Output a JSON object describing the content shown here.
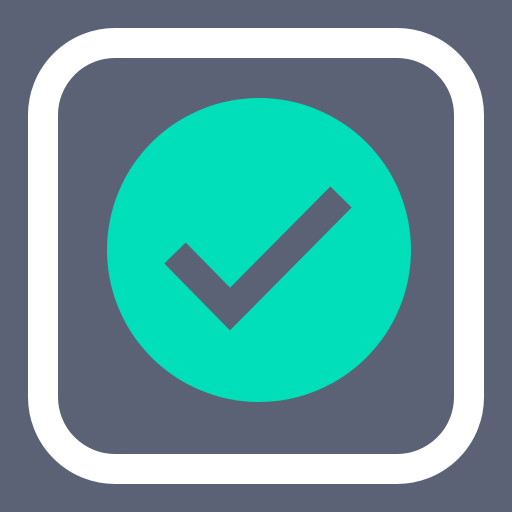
{
  "icon": {
    "name": "checkmark-circle-icon",
    "background_color": "#5b6275",
    "frame_color": "#ffffff",
    "circle_color": "#00dfb9",
    "check_color": "#5b6275"
  }
}
